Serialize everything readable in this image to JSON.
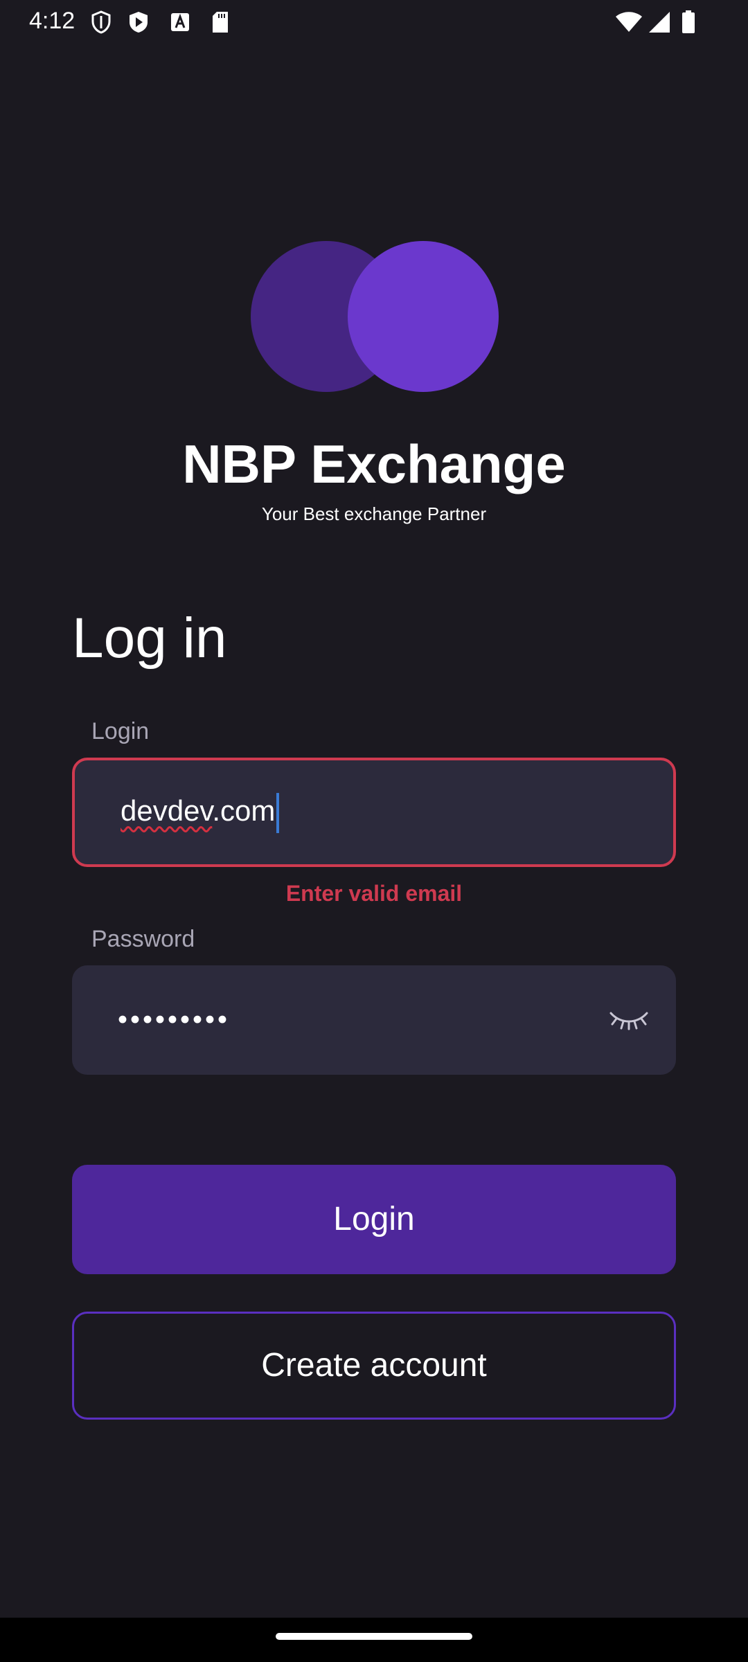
{
  "status_bar": {
    "time": "4:12",
    "icons_left": [
      "shield-icon",
      "play-store-icon",
      "font-icon",
      "sd-card-icon"
    ],
    "icons_right": [
      "wifi-icon",
      "cellular-signal-icon",
      "battery-icon"
    ]
  },
  "brand": {
    "title": "NBP Exchange",
    "subtitle": "Your Best exchange Partner",
    "logo_colors": [
      "#452583",
      "#6b38cd"
    ]
  },
  "form": {
    "heading": "Log in",
    "login": {
      "label": "Login",
      "value_misspelled": "devdev",
      "value_rest": ".com",
      "error": "Enter valid email"
    },
    "password": {
      "label": "Password",
      "masked_value": "•••••••••",
      "toggle_icon": "eye-closed-icon"
    },
    "login_button": "Login",
    "create_account_button": "Create account"
  },
  "colors": {
    "background": "#1b1920",
    "input_background": "#2c2a3c",
    "error": "#cf3a50",
    "primary": "#4e279b",
    "outline": "#5a2fc0"
  }
}
